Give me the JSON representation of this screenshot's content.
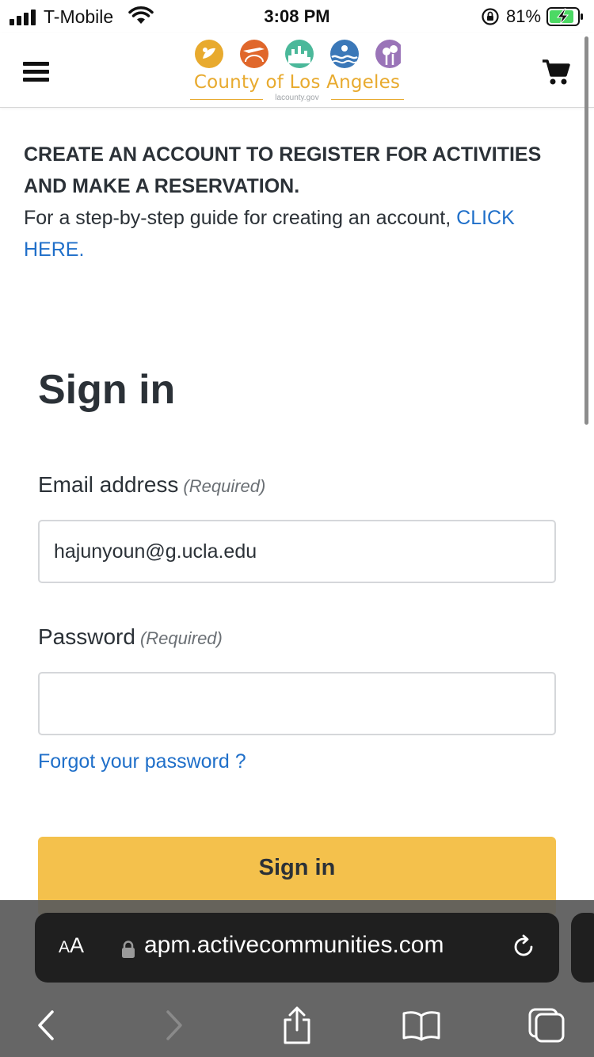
{
  "status_bar": {
    "carrier": "T-Mobile",
    "time": "3:08 PM",
    "battery_percent": "81%"
  },
  "header": {
    "logo_title": "County of Los Angeles",
    "logo_subtitle": "lacounty.gov",
    "logo_colors": [
      "#e8aa2e",
      "#e0672b",
      "#4bb89a",
      "#3b78b8",
      "#9a74b8"
    ]
  },
  "notice": {
    "heading": "CREATE AN ACCOUNT TO REGISTER FOR ACTIVITIES AND MAKE A RESERVATION.",
    "body": "For a step-by-step guide for creating an account, ",
    "link": "CLICK HERE",
    "trailing": "."
  },
  "signin": {
    "title": "Sign in",
    "email_label": "Email address",
    "email_required": "(Required)",
    "email_value": "hajunyoun@g.ucla.edu",
    "password_label": "Password",
    "password_required": "(Required)",
    "password_value": "",
    "forgot_link": "Forgot your password ?",
    "button_label": "Sign in"
  },
  "browser": {
    "aa_big": "A",
    "aa_small": "A",
    "url": "apm.activecommunities.com"
  },
  "colors": {
    "link": "#1f6fc9",
    "button": "#f4c14c",
    "text": "#2b3137"
  }
}
